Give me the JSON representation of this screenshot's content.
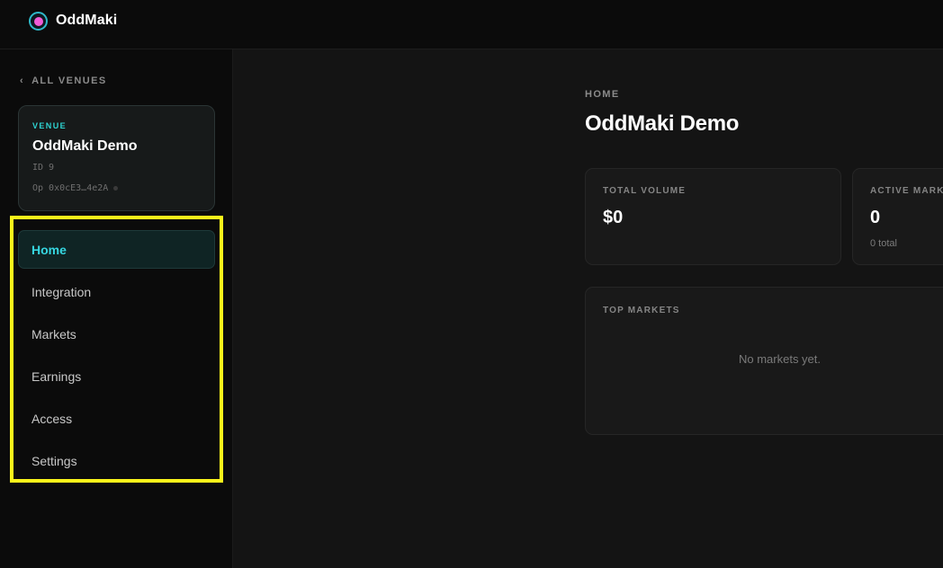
{
  "app": {
    "name": "OddMaki",
    "colors": {
      "accent": "#36d6e0",
      "logo_dot": "#f05bd6",
      "highlight": "#fbf51a"
    }
  },
  "sidebar": {
    "back_label": "ALL VENUES",
    "venue": {
      "eyebrow": "VENUE",
      "name": "OddMaki Demo",
      "id_text": "ID 9",
      "op_text": "Op 0x0cE3…4e2A"
    },
    "nav": [
      {
        "label": "Home",
        "active": true
      },
      {
        "label": "Integration",
        "active": false
      },
      {
        "label": "Markets",
        "active": false
      },
      {
        "label": "Earnings",
        "active": false
      },
      {
        "label": "Access",
        "active": false
      },
      {
        "label": "Settings",
        "active": false
      }
    ]
  },
  "main": {
    "breadcrumb": "HOME",
    "title": "OddMaki Demo",
    "stats": {
      "total_volume": {
        "label": "TOTAL VOLUME",
        "value": "$0"
      },
      "active_markets": {
        "label": "ACTIVE MARKETS",
        "value": "0",
        "sub": "0 total"
      }
    },
    "top_markets": {
      "title": "TOP MARKETS",
      "empty_text": "No markets yet."
    }
  }
}
